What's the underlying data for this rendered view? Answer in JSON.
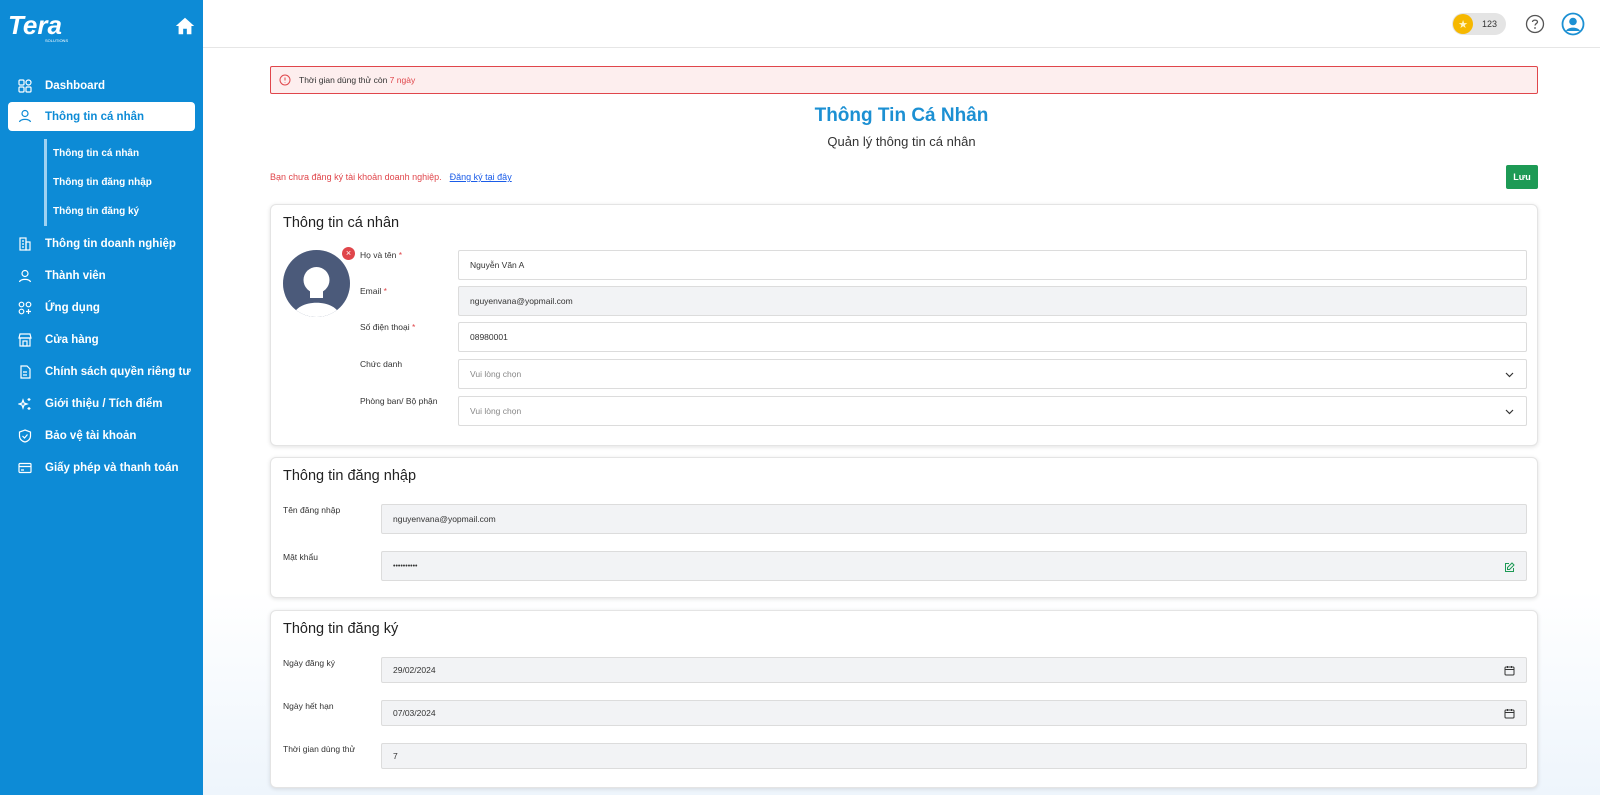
{
  "sidebar": {
    "logo_text": "Tera",
    "logo_sub": "SOLUTIONS",
    "items": [
      {
        "label": "Dashboard"
      },
      {
        "label": "Thông tin cá nhân"
      },
      {
        "label": "Thông tin doanh nghiệp"
      },
      {
        "label": "Thành viên"
      },
      {
        "label": "Ứng dụng"
      },
      {
        "label": "Cửa hàng"
      },
      {
        "label": "Chính sách quyền riêng tư"
      },
      {
        "label": "Giới thiệu / Tích điểm"
      },
      {
        "label": "Bảo vệ tài khoản"
      },
      {
        "label": "Giấy phép và thanh toán"
      }
    ],
    "sub_items": [
      {
        "label": "Thông tin cá nhân"
      },
      {
        "label": "Thông tin đăng nhập"
      },
      {
        "label": "Thông tin đăng ký"
      }
    ]
  },
  "topbar": {
    "coin_count": "123",
    "coin_symbol": "★"
  },
  "alert": {
    "prefix": "Thời gian dùng thử còn ",
    "highlight": "7 ngày"
  },
  "page": {
    "title": "Thông Tin Cá Nhân",
    "subtitle": "Quản lý thông tin cá nhân"
  },
  "notice": {
    "text": "Bạn chưa đăng ký tài khoản doanh nghiệp.",
    "link": "Đăng ký tại đây"
  },
  "save_label": "Lưu",
  "personal": {
    "title": "Thông tin cá nhân",
    "avatar_remove": "×",
    "name_label": "Họ và tên",
    "name_value": "Nguyễn Văn A",
    "email_label": "Email",
    "email_value": "nguyenvana@yopmail.com",
    "phone_label": "Số điện thoại",
    "phone_value": "08980001",
    "title_label": "Chức danh",
    "title_placeholder": "Vui lòng chọn",
    "dept_label": "Phòng ban/ Bộ phận",
    "dept_placeholder": "Vui lòng chọn",
    "required_mark": "*"
  },
  "login": {
    "title": "Thông tin đăng nhập",
    "username_label": "Tên đăng nhập",
    "username_value": "nguyenvana@yopmail.com",
    "password_label": "Mật khẩu",
    "password_value": "••••••••••"
  },
  "registration": {
    "title": "Thông tin đăng ký",
    "reg_date_label": "Ngày đăng ký",
    "reg_date_value": "29/02/2024",
    "exp_date_label": "Ngày hết hạn",
    "exp_date_value": "07/03/2024",
    "trial_label": "Thời gian dùng thử",
    "trial_value": "7"
  },
  "colors": {
    "brand": "#0d8bd6",
    "save": "#1d9a55",
    "danger": "#e0464b",
    "title": "#1c90d3"
  }
}
